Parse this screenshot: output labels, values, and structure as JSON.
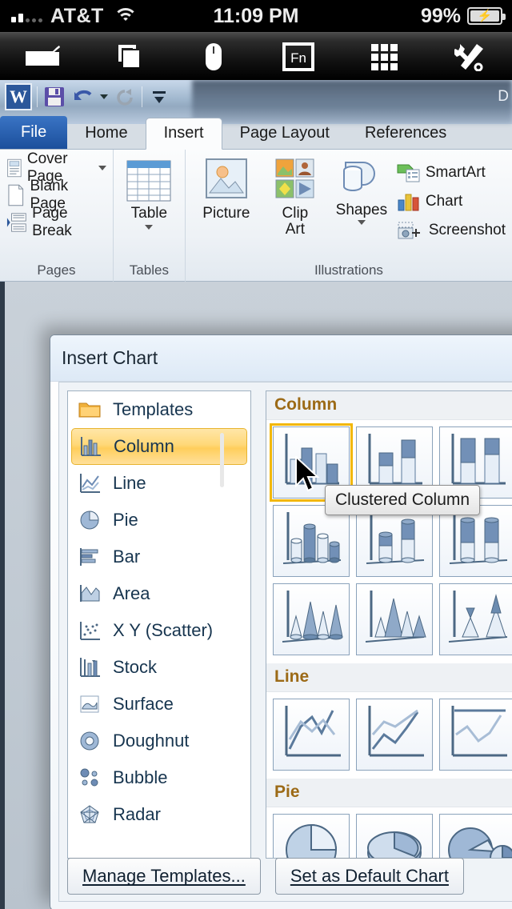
{
  "ios_status": {
    "carrier": "AT&T",
    "time": "11:09 PM",
    "battery_pct": "99%",
    "signal_icon": "signal-bars-icon",
    "wifi_icon": "wifi-icon",
    "battery_icon": "battery-charging-icon"
  },
  "vnc_toolbar": {
    "buttons": [
      {
        "name": "keyboard-icon",
        "label": "Keyboard"
      },
      {
        "name": "windows-icon",
        "label": "Windows"
      },
      {
        "name": "mouse-icon",
        "label": "Mouse"
      },
      {
        "name": "fn-icon",
        "label": "Fn"
      },
      {
        "name": "grid-icon",
        "label": "Grid"
      },
      {
        "name": "tools-icon",
        "label": "Tools"
      }
    ]
  },
  "word": {
    "document_title": "D",
    "quick_access": [
      {
        "name": "word-logo",
        "label": "W"
      },
      {
        "name": "save-icon",
        "label": "Save"
      },
      {
        "name": "undo-icon",
        "label": "Undo"
      },
      {
        "name": "redo-icon",
        "label": "Redo"
      },
      {
        "name": "customize-qat-icon",
        "label": "Customize Quick Access Toolbar"
      }
    ],
    "tabs": [
      {
        "label": "File",
        "state": "file"
      },
      {
        "label": "Home",
        "state": "normal"
      },
      {
        "label": "Insert",
        "state": "active"
      },
      {
        "label": "Page Layout",
        "state": "normal"
      },
      {
        "label": "References",
        "state": "normal"
      }
    ],
    "ribbon": {
      "groups": [
        {
          "label": "Pages",
          "items": [
            {
              "label": "Cover Page",
              "dropdown": true
            },
            {
              "label": "Blank Page",
              "dropdown": false
            },
            {
              "label": "Page Break",
              "dropdown": false
            }
          ]
        },
        {
          "label": "Tables",
          "items": [
            {
              "label": "Table",
              "dropdown": true
            }
          ]
        },
        {
          "label": "Illustrations",
          "items": [
            {
              "label": "Picture",
              "dropdown": false
            },
            {
              "label": "Clip\nArt",
              "dropdown": false
            },
            {
              "label": "Shapes",
              "dropdown": true
            },
            {
              "label": "SmartArt",
              "dropdown": false
            },
            {
              "label": "Chart",
              "dropdown": false
            },
            {
              "label": "Screenshot",
              "dropdown": false
            }
          ]
        }
      ],
      "illustration_small": [
        "SmartArt",
        "Chart",
        "Screenshot"
      ],
      "pages_items": [
        "Cover Page",
        "Blank Page",
        "Page Break"
      ],
      "table_label": "Table",
      "picture_label": "Picture",
      "clipart_label_line1": "Clip",
      "clipart_label_line2": "Art",
      "shapes_label": "Shapes",
      "group_labels": {
        "pages": "Pages",
        "tables": "Tables",
        "illustrations": "Illustrations"
      }
    }
  },
  "dialog": {
    "title": "Insert Chart",
    "selected_type": "Column",
    "chart_types": [
      {
        "label": "Templates",
        "icon": "folder-icon",
        "selected": false
      },
      {
        "label": "Column",
        "icon": "column-chart-icon",
        "selected": true
      },
      {
        "label": "Line",
        "icon": "line-chart-icon",
        "selected": false
      },
      {
        "label": "Pie",
        "icon": "pie-chart-icon",
        "selected": false
      },
      {
        "label": "Bar",
        "icon": "bar-chart-icon",
        "selected": false
      },
      {
        "label": "Area",
        "icon": "area-chart-icon",
        "selected": false
      },
      {
        "label": "X Y (Scatter)",
        "icon": "scatter-chart-icon",
        "selected": false
      },
      {
        "label": "Stock",
        "icon": "stock-chart-icon",
        "selected": false
      },
      {
        "label": "Surface",
        "icon": "surface-chart-icon",
        "selected": false
      },
      {
        "label": "Doughnut",
        "icon": "doughnut-chart-icon",
        "selected": false
      },
      {
        "label": "Bubble",
        "icon": "bubble-chart-icon",
        "selected": false
      },
      {
        "label": "Radar",
        "icon": "radar-chart-icon",
        "selected": false
      }
    ],
    "gallery": {
      "sections": [
        {
          "heading": "Column",
          "rows": [
            [
              {
                "name": "clustered-column",
                "selected": true
              },
              {
                "name": "stacked-column",
                "selected": false
              },
              {
                "name": "100-percent-stacked-column",
                "selected": false
              }
            ],
            [
              {
                "name": "clustered-cylinder",
                "selected": false
              },
              {
                "name": "stacked-cylinder",
                "selected": false
              },
              {
                "name": "100-percent-stacked-cylinder",
                "selected": false
              }
            ],
            [
              {
                "name": "clustered-cone",
                "selected": false
              },
              {
                "name": "stacked-cone",
                "selected": false
              },
              {
                "name": "100-percent-stacked-cone",
                "selected": false
              }
            ]
          ]
        },
        {
          "heading": "Line",
          "rows": [
            [
              {
                "name": "line-chart",
                "selected": false
              },
              {
                "name": "stacked-line",
                "selected": false
              },
              {
                "name": "100-percent-stacked-line",
                "selected": false
              }
            ]
          ]
        },
        {
          "heading": "Pie",
          "rows": [
            [
              {
                "name": "pie-chart",
                "selected": false
              },
              {
                "name": "pie-3d-chart",
                "selected": false
              },
              {
                "name": "pie-of-pie-chart",
                "selected": false
              }
            ]
          ]
        }
      ]
    },
    "tooltip": "Clustered Column",
    "buttons": {
      "manage_templates": "Manage Templates...",
      "manage_templates_accel": "M",
      "set_as_default": "Set as Default Chart",
      "set_as_default_accel": "S"
    }
  },
  "colors": {
    "selection_gold": "#ffce5c",
    "section_heading": "#9c6a16",
    "word_blue": "#2b579a",
    "chart_blue": "#6e8cb5"
  }
}
